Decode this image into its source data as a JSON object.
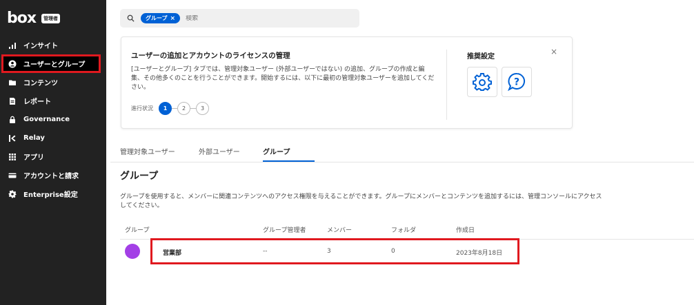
{
  "sidebar": {
    "logo": "box",
    "admin_badge": "管理者",
    "items": [
      {
        "label": "インサイト",
        "icon": "bar-chart-icon"
      },
      {
        "label": "ユーザーとグループ",
        "icon": "user-circle-icon"
      },
      {
        "label": "コンテンツ",
        "icon": "folder-icon"
      },
      {
        "label": "レポート",
        "icon": "report-icon"
      },
      {
        "label": "Governance",
        "icon": "lock-icon"
      },
      {
        "label": "Relay",
        "icon": "relay-icon"
      },
      {
        "label": "アプリ",
        "icon": "apps-grid-icon"
      },
      {
        "label": "アカウントと請求",
        "icon": "card-icon"
      },
      {
        "label": "Enterprise設定",
        "icon": "gear-icon"
      }
    ]
  },
  "search": {
    "chip_label": "グループ",
    "chip_remove": "×",
    "placeholder": "検索"
  },
  "onboarding": {
    "title": "ユーザーの追加とアカウントのライセンスの管理",
    "body": "[ユーザーとグループ] タブでは、管理対象ユーザー (外部ユーザーではない) の追加、グループの作成と編集、その他多くのことを行うことができます。開始するには、以下に最初の管理対象ユーザーを追加してください。",
    "progress_label": "進行状況",
    "steps": [
      "1",
      "2",
      "3"
    ],
    "recommended_title": "推奨設定",
    "close": "×"
  },
  "tabs": [
    {
      "label": "管理対象ユーザー"
    },
    {
      "label": "外部ユーザー"
    },
    {
      "label": "グループ"
    }
  ],
  "groups": {
    "title": "グループ",
    "description": "グループを使用すると、メンバーに関連コンテンツへのアクセス権限を与えることができます。グループにメンバーとコンテンツを追加するには、管理コンソールにアクセスしてください。",
    "columns": [
      "グループ",
      "グループ管理者",
      "メンバー",
      "フォルダ",
      "作成日"
    ],
    "rows": [
      {
        "name": "営業部",
        "admin": "--",
        "members": "3",
        "folders": "0",
        "created": "2023年8月18日",
        "avatar_color": "#a33fe6"
      }
    ]
  },
  "colors": {
    "accent": "#0061d5",
    "highlight": "#e0191f",
    "sidebar": "#222222"
  }
}
